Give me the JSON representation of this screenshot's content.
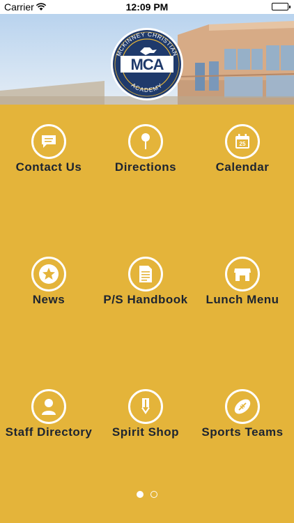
{
  "status_bar": {
    "carrier": "Carrier",
    "time": "12:09 PM"
  },
  "header": {
    "logo_ring_text_top": "MCKINNEY CHRISTIAN",
    "logo_ring_text_bottom": "ACADEMY",
    "logo_letters": "MCA"
  },
  "grid": [
    {
      "label": "Contact Us",
      "icon": "chat-bubble-icon"
    },
    {
      "label": "Directions",
      "icon": "map-pin-icon"
    },
    {
      "label": "Calendar",
      "icon": "calendar-icon"
    },
    {
      "label": "News",
      "icon": "star-icon"
    },
    {
      "label": "P/S Handbook",
      "icon": "document-icon"
    },
    {
      "label": "Lunch Menu",
      "icon": "store-icon"
    },
    {
      "label": "Staff Directory",
      "icon": "person-icon"
    },
    {
      "label": "Spirit Shop",
      "icon": "tag-icon"
    },
    {
      "label": "Sports Teams",
      "icon": "football-icon"
    }
  ],
  "calendar_day": "25",
  "page_indicator": {
    "pages": 2,
    "current": 1
  },
  "colors": {
    "background": "#E4B43A",
    "label": "#1d2430",
    "logo_navy": "#1f3a6b"
  }
}
